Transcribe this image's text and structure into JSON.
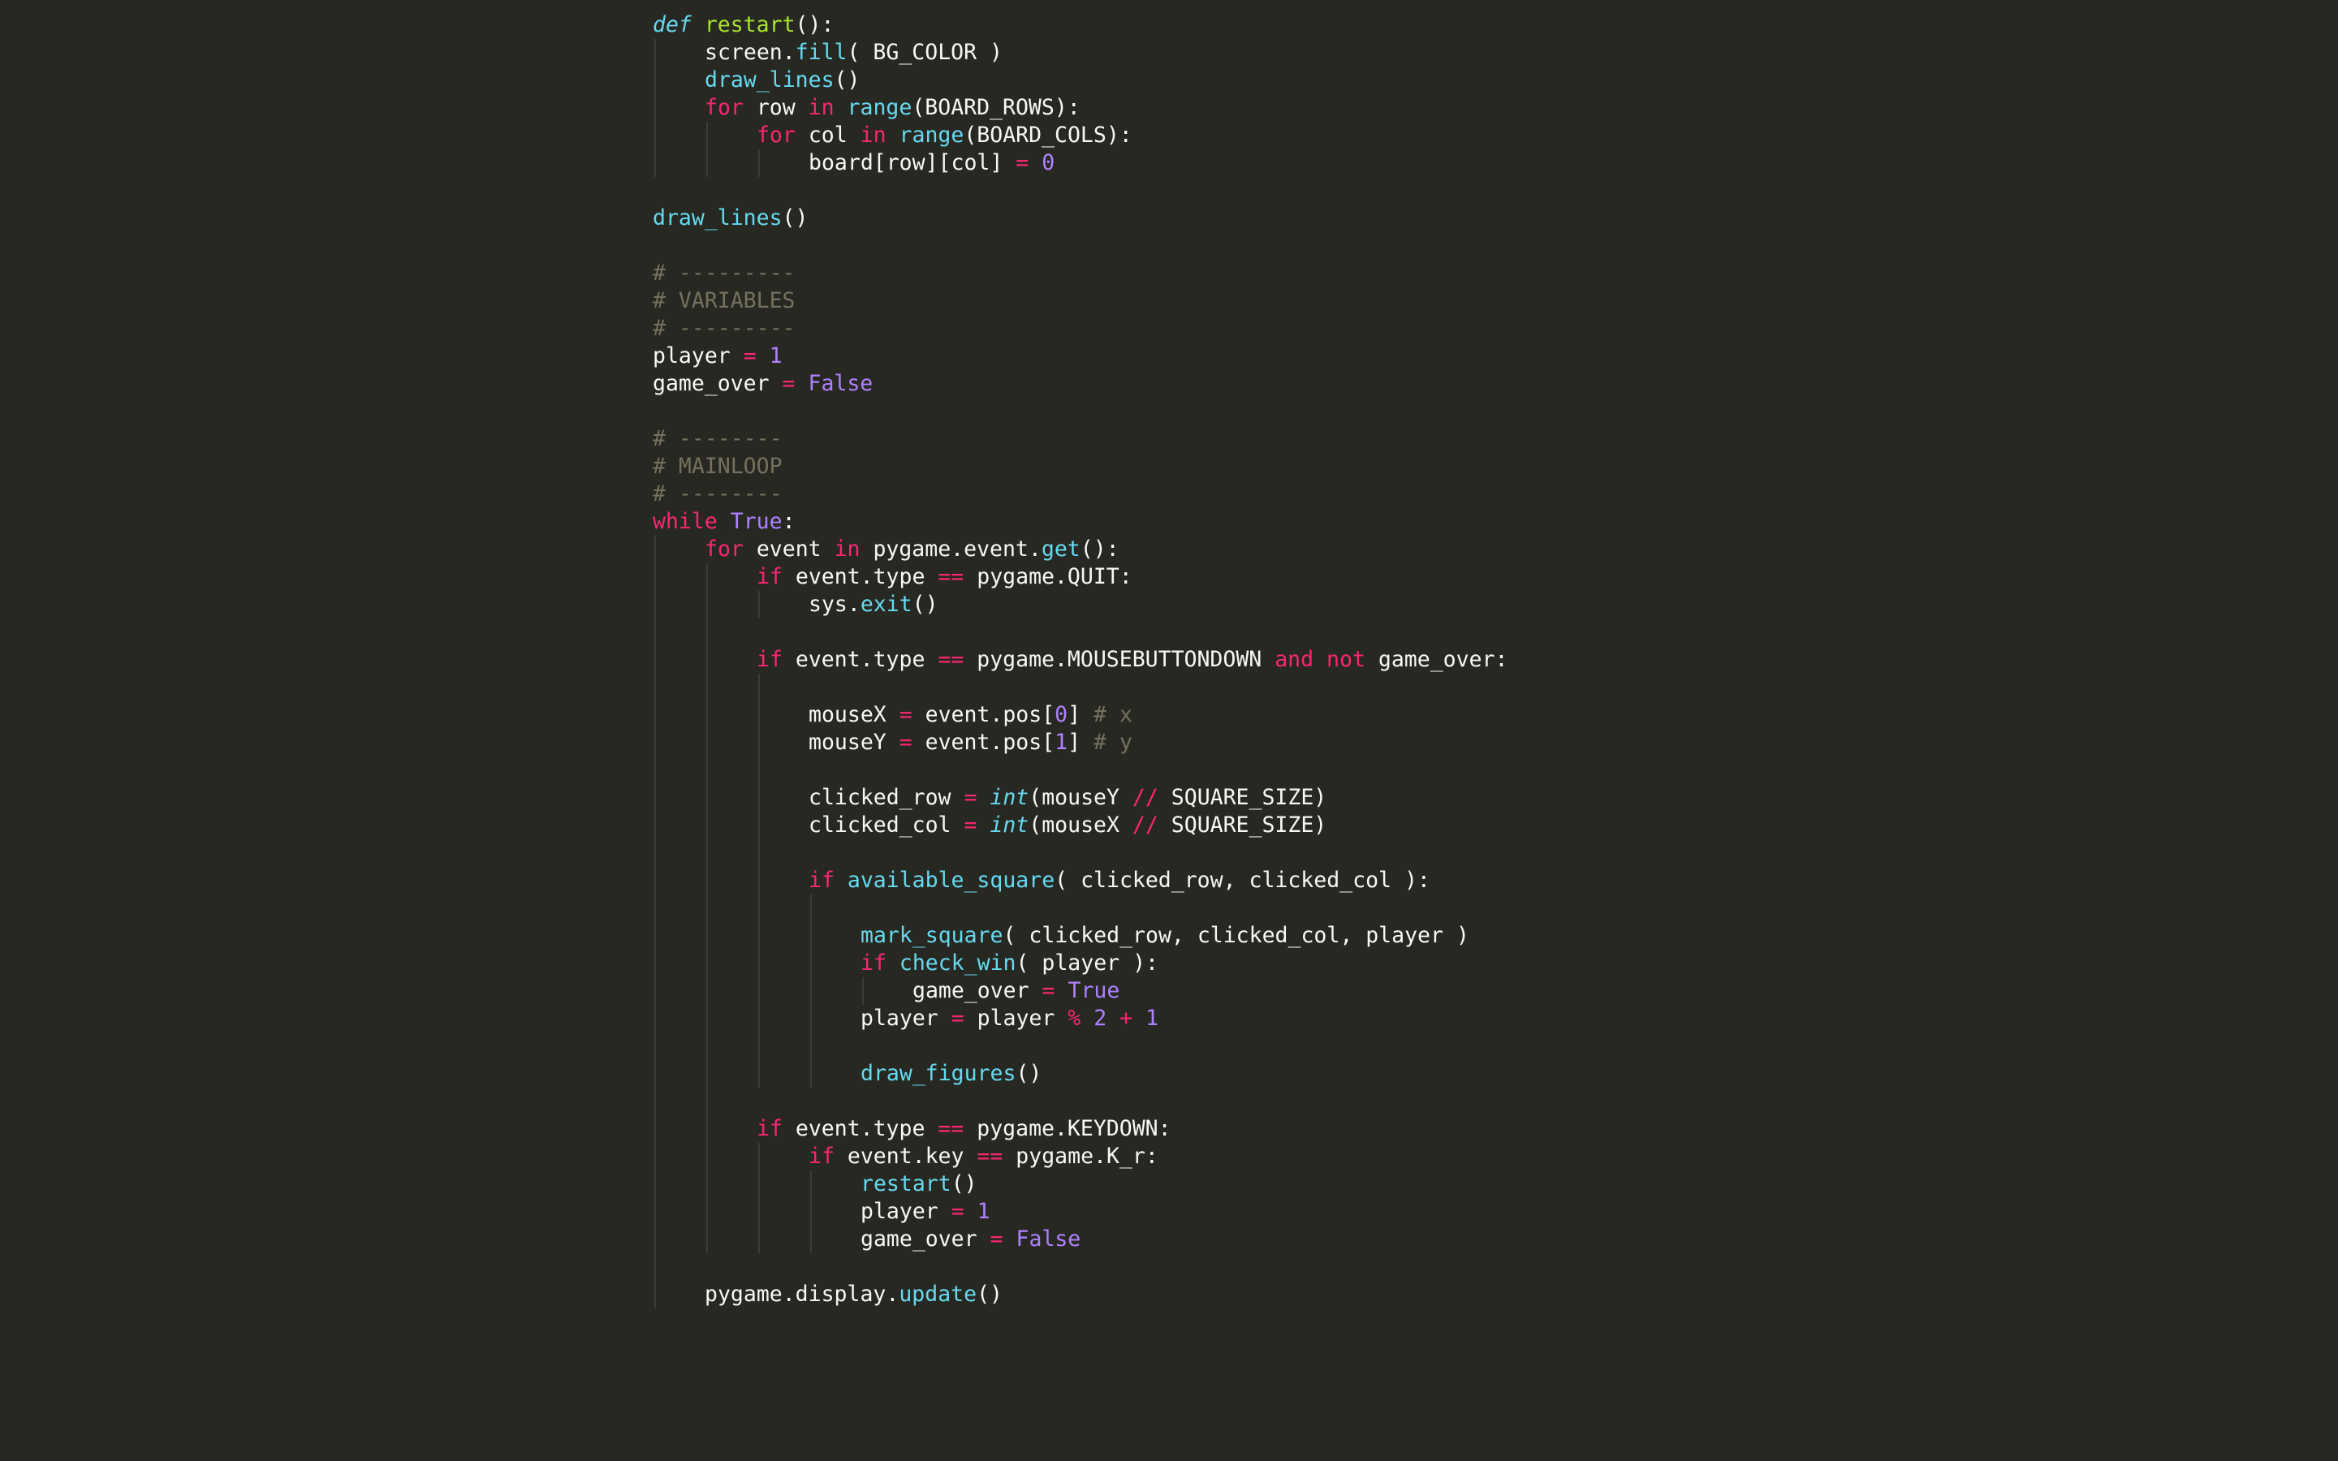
{
  "editor": {
    "theme": "monokai",
    "colors": {
      "background": "#272822",
      "plain": "#f8f8f2",
      "keyword": "#f92672",
      "definition": "#66d9ef",
      "function_name": "#a6e22e",
      "call": "#66d9ef",
      "number": "#ae81ff",
      "operator": "#f92672",
      "comment": "#75715e",
      "indent_guide": "#3b3c35"
    },
    "lines": [
      {
        "indent": 0,
        "tokens": [
          {
            "t": "def",
            "c": "def"
          },
          {
            "t": " "
          },
          {
            "t": "restart",
            "c": "fn"
          },
          {
            "t": "():"
          }
        ]
      },
      {
        "indent": 1,
        "tokens": [
          {
            "t": "screen."
          },
          {
            "t": "fill",
            "c": "call"
          },
          {
            "t": "( BG_COLOR )"
          }
        ]
      },
      {
        "indent": 1,
        "tokens": [
          {
            "t": "draw_lines",
            "c": "call"
          },
          {
            "t": "()"
          }
        ]
      },
      {
        "indent": 1,
        "tokens": [
          {
            "t": "for",
            "c": "kw"
          },
          {
            "t": " row "
          },
          {
            "t": "in",
            "c": "kw"
          },
          {
            "t": " "
          },
          {
            "t": "range",
            "c": "call"
          },
          {
            "t": "(BOARD_ROWS):"
          }
        ]
      },
      {
        "indent": 2,
        "tokens": [
          {
            "t": "for",
            "c": "kw"
          },
          {
            "t": " col "
          },
          {
            "t": "in",
            "c": "kw"
          },
          {
            "t": " "
          },
          {
            "t": "range",
            "c": "call"
          },
          {
            "t": "(BOARD_COLS):"
          }
        ]
      },
      {
        "indent": 3,
        "tokens": [
          {
            "t": "board[row][col] "
          },
          {
            "t": "=",
            "c": "op"
          },
          {
            "t": " "
          },
          {
            "t": "0",
            "c": "num"
          }
        ]
      },
      {
        "indent": 0,
        "guides": 0,
        "tokens": []
      },
      {
        "indent": 0,
        "tokens": [
          {
            "t": "draw_lines",
            "c": "call"
          },
          {
            "t": "()"
          }
        ]
      },
      {
        "indent": 0,
        "tokens": []
      },
      {
        "indent": 0,
        "tokens": [
          {
            "t": "# ---------",
            "c": "cm"
          }
        ]
      },
      {
        "indent": 0,
        "tokens": [
          {
            "t": "# VARIABLES",
            "c": "cm"
          }
        ]
      },
      {
        "indent": 0,
        "tokens": [
          {
            "t": "# ---------",
            "c": "cm"
          }
        ]
      },
      {
        "indent": 0,
        "tokens": [
          {
            "t": "player "
          },
          {
            "t": "=",
            "c": "op"
          },
          {
            "t": " "
          },
          {
            "t": "1",
            "c": "num"
          }
        ]
      },
      {
        "indent": 0,
        "tokens": [
          {
            "t": "game_over "
          },
          {
            "t": "=",
            "c": "op"
          },
          {
            "t": " "
          },
          {
            "t": "False",
            "c": "num"
          }
        ]
      },
      {
        "indent": 0,
        "tokens": []
      },
      {
        "indent": 0,
        "tokens": [
          {
            "t": "# --------",
            "c": "cm"
          }
        ]
      },
      {
        "indent": 0,
        "tokens": [
          {
            "t": "# MAINLOOP",
            "c": "cm"
          }
        ]
      },
      {
        "indent": 0,
        "tokens": [
          {
            "t": "# --------",
            "c": "cm"
          }
        ]
      },
      {
        "indent": 0,
        "tokens": [
          {
            "t": "while",
            "c": "kw"
          },
          {
            "t": " "
          },
          {
            "t": "True",
            "c": "num"
          },
          {
            "t": ":"
          }
        ]
      },
      {
        "indent": 1,
        "tokens": [
          {
            "t": "for",
            "c": "kw"
          },
          {
            "t": " event "
          },
          {
            "t": "in",
            "c": "kw"
          },
          {
            "t": " pygame.event."
          },
          {
            "t": "get",
            "c": "call"
          },
          {
            "t": "():"
          }
        ]
      },
      {
        "indent": 2,
        "tokens": [
          {
            "t": "if",
            "c": "kw"
          },
          {
            "t": " event.type "
          },
          {
            "t": "==",
            "c": "op"
          },
          {
            "t": " pygame.QUIT:"
          }
        ]
      },
      {
        "indent": 3,
        "tokens": [
          {
            "t": "sys."
          },
          {
            "t": "exit",
            "c": "call"
          },
          {
            "t": "()"
          }
        ]
      },
      {
        "indent": 0,
        "guides": 2,
        "tokens": []
      },
      {
        "indent": 2,
        "tokens": [
          {
            "t": "if",
            "c": "kw"
          },
          {
            "t": " event.type "
          },
          {
            "t": "==",
            "c": "op"
          },
          {
            "t": " pygame.MOUSEBUTTONDOWN "
          },
          {
            "t": "and",
            "c": "kw"
          },
          {
            "t": " "
          },
          {
            "t": "not",
            "c": "kw"
          },
          {
            "t": " game_over:"
          }
        ]
      },
      {
        "indent": 0,
        "guides": 3,
        "tokens": []
      },
      {
        "indent": 3,
        "tokens": [
          {
            "t": "mouseX "
          },
          {
            "t": "=",
            "c": "op"
          },
          {
            "t": " event.pos["
          },
          {
            "t": "0",
            "c": "num"
          },
          {
            "t": "] "
          },
          {
            "t": "# x",
            "c": "cm"
          }
        ]
      },
      {
        "indent": 3,
        "tokens": [
          {
            "t": "mouseY "
          },
          {
            "t": "=",
            "c": "op"
          },
          {
            "t": " event.pos["
          },
          {
            "t": "1",
            "c": "num"
          },
          {
            "t": "] "
          },
          {
            "t": "# y",
            "c": "cm"
          }
        ]
      },
      {
        "indent": 0,
        "guides": 3,
        "tokens": []
      },
      {
        "indent": 3,
        "tokens": [
          {
            "t": "clicked_row "
          },
          {
            "t": "=",
            "c": "op"
          },
          {
            "t": " "
          },
          {
            "t": "int",
            "c": "italic"
          },
          {
            "t": "(mouseY "
          },
          {
            "t": "//",
            "c": "op"
          },
          {
            "t": " SQUARE_SIZE)"
          }
        ]
      },
      {
        "indent": 3,
        "tokens": [
          {
            "t": "clicked_col "
          },
          {
            "t": "=",
            "c": "op"
          },
          {
            "t": " "
          },
          {
            "t": "int",
            "c": "italic"
          },
          {
            "t": "(mouseX "
          },
          {
            "t": "//",
            "c": "op"
          },
          {
            "t": " SQUARE_SIZE)"
          }
        ]
      },
      {
        "indent": 0,
        "guides": 3,
        "tokens": []
      },
      {
        "indent": 3,
        "tokens": [
          {
            "t": "if",
            "c": "kw"
          },
          {
            "t": " "
          },
          {
            "t": "available_square",
            "c": "call"
          },
          {
            "t": "( clicked_row, clicked_col ):"
          }
        ]
      },
      {
        "indent": 0,
        "guides": 4,
        "tokens": []
      },
      {
        "indent": 4,
        "tokens": [
          {
            "t": "mark_square",
            "c": "call"
          },
          {
            "t": "( clicked_row, clicked_col, player )"
          }
        ]
      },
      {
        "indent": 4,
        "tokens": [
          {
            "t": "if",
            "c": "kw"
          },
          {
            "t": " "
          },
          {
            "t": "check_win",
            "c": "call"
          },
          {
            "t": "( player ):"
          }
        ]
      },
      {
        "indent": 5,
        "tokens": [
          {
            "t": "game_over "
          },
          {
            "t": "=",
            "c": "op"
          },
          {
            "t": " "
          },
          {
            "t": "True",
            "c": "num"
          }
        ]
      },
      {
        "indent": 4,
        "tokens": [
          {
            "t": "player "
          },
          {
            "t": "=",
            "c": "op"
          },
          {
            "t": " player "
          },
          {
            "t": "%",
            "c": "op"
          },
          {
            "t": " "
          },
          {
            "t": "2",
            "c": "num"
          },
          {
            "t": " "
          },
          {
            "t": "+",
            "c": "op"
          },
          {
            "t": " "
          },
          {
            "t": "1",
            "c": "num"
          }
        ]
      },
      {
        "indent": 0,
        "guides": 4,
        "tokens": []
      },
      {
        "indent": 4,
        "tokens": [
          {
            "t": "draw_figures",
            "c": "call"
          },
          {
            "t": "()"
          }
        ]
      },
      {
        "indent": 0,
        "guides": 2,
        "tokens": []
      },
      {
        "indent": 2,
        "tokens": [
          {
            "t": "if",
            "c": "kw"
          },
          {
            "t": " event.type "
          },
          {
            "t": "==",
            "c": "op"
          },
          {
            "t": " pygame.KEYDOWN:"
          }
        ]
      },
      {
        "indent": 3,
        "tokens": [
          {
            "t": "if",
            "c": "kw"
          },
          {
            "t": " event.key "
          },
          {
            "t": "==",
            "c": "op"
          },
          {
            "t": " pygame.K_r:"
          }
        ]
      },
      {
        "indent": 4,
        "tokens": [
          {
            "t": "restart",
            "c": "call"
          },
          {
            "t": "()"
          }
        ]
      },
      {
        "indent": 4,
        "tokens": [
          {
            "t": "player "
          },
          {
            "t": "=",
            "c": "op"
          },
          {
            "t": " "
          },
          {
            "t": "1",
            "c": "num"
          }
        ]
      },
      {
        "indent": 4,
        "tokens": [
          {
            "t": "game_over "
          },
          {
            "t": "=",
            "c": "op"
          },
          {
            "t": " "
          },
          {
            "t": "False",
            "c": "num"
          }
        ]
      },
      {
        "indent": 0,
        "guides": 1,
        "tokens": []
      },
      {
        "indent": 1,
        "tokens": [
          {
            "t": "pygame.display."
          },
          {
            "t": "update",
            "c": "call"
          },
          {
            "t": "()"
          }
        ]
      }
    ]
  }
}
